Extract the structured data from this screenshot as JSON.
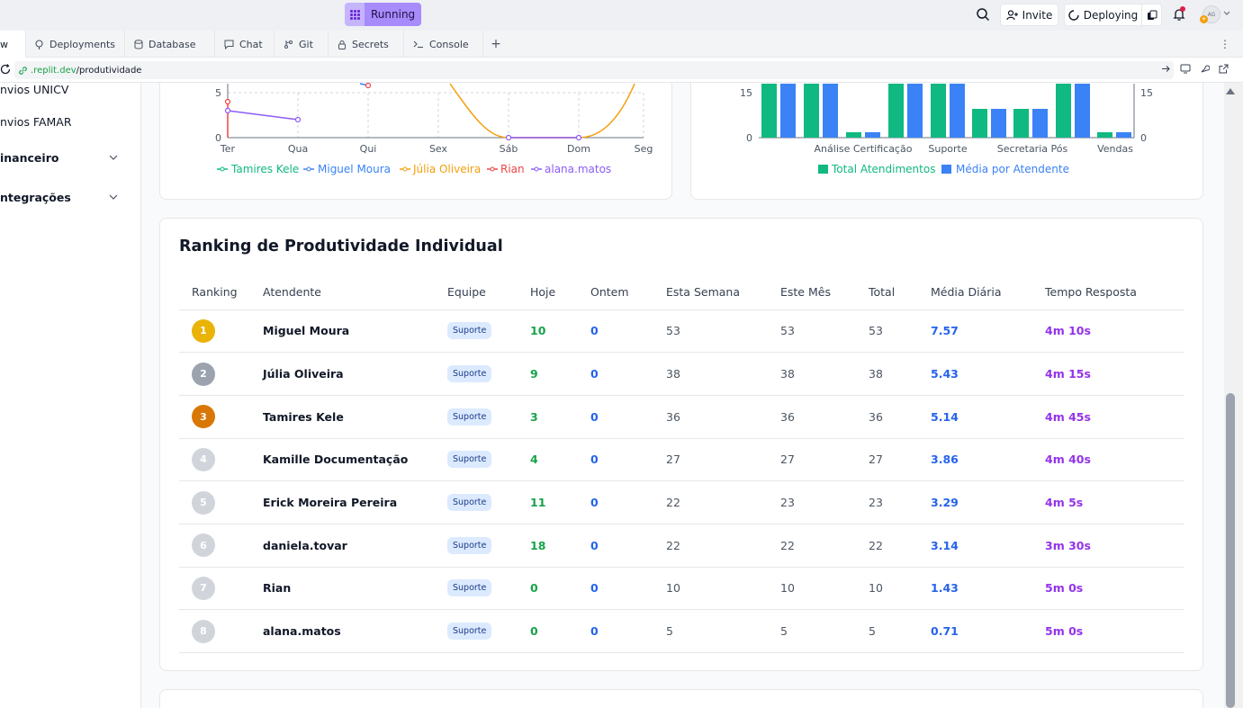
{
  "topbar": {
    "run_label": "Running",
    "invite_label": "Invite",
    "deploy_label": "Deploying",
    "avatar_initials": "AG",
    "avatar_badge": "+"
  },
  "tabs": [
    {
      "label": "w",
      "icon": "preview-icon",
      "active": true
    },
    {
      "label": "Deployments",
      "icon": "deploy-icon"
    },
    {
      "label": "Database",
      "icon": "database-icon"
    },
    {
      "label": "Chat",
      "icon": "chat-icon"
    },
    {
      "label": "Git",
      "icon": "git-icon"
    },
    {
      "label": "Secrets",
      "icon": "lock-icon"
    },
    {
      "label": "Console",
      "icon": "terminal-icon"
    }
  ],
  "tab_plus": "+",
  "tab_more": "⋮",
  "url": {
    "host": ".replit.dev",
    "path": "/produtividade"
  },
  "sidebar": {
    "items": [
      "nvios UNICV",
      "nvios FAMAR",
      "inanceiro",
      "ntegrações"
    ]
  },
  "line_chart": {
    "y_ticks": [
      "0",
      "5"
    ],
    "x_ticks": [
      "Ter",
      "Qua",
      "Qui",
      "Sex",
      "Sáb",
      "Dom",
      "Seg"
    ],
    "series": [
      {
        "name": "Tamires Kele",
        "color": "#10b981"
      },
      {
        "name": "Miguel Moura",
        "color": "#3b82f6"
      },
      {
        "name": "Júlia Oliveira",
        "color": "#f59e0b"
      },
      {
        "name": "Rian",
        "color": "#ef4444"
      },
      {
        "name": "alana.matos",
        "color": "#8b5cf6"
      }
    ]
  },
  "bar_chart": {
    "y_ticks": [
      "0",
      "15"
    ],
    "y2_ticks": [
      "0",
      "15"
    ],
    "x_ticks": [
      "Análise Certificação",
      "Suporte",
      "Secretaria Pós",
      "Vendas"
    ],
    "legend": [
      {
        "name": "Total Atendimentos",
        "color": "#10b981"
      },
      {
        "name": "Média por Atendente",
        "color": "#3b82f6"
      }
    ]
  },
  "ranking": {
    "title": "Ranking de Produtividade Individual",
    "headers": [
      "Ranking",
      "Atendente",
      "Equipe",
      "Hoje",
      "Ontem",
      "Esta Semana",
      "Este Mês",
      "Total",
      "Média Diária",
      "Tempo Resposta"
    ],
    "rows": [
      {
        "rank": "1",
        "color": "#eab308",
        "name": "Miguel Moura",
        "team": "Suporte",
        "hoje": "10",
        "ontem": "0",
        "semana": "53",
        "mes": "53",
        "total": "53",
        "media": "7.57",
        "tempo": "4m 10s"
      },
      {
        "rank": "2",
        "color": "#9ca3af",
        "name": "Júlia Oliveira",
        "team": "Suporte",
        "hoje": "9",
        "ontem": "0",
        "semana": "38",
        "mes": "38",
        "total": "38",
        "media": "5.43",
        "tempo": "4m 15s"
      },
      {
        "rank": "3",
        "color": "#d97706",
        "name": "Tamires Kele",
        "team": "Suporte",
        "hoje": "3",
        "ontem": "0",
        "semana": "36",
        "mes": "36",
        "total": "36",
        "media": "5.14",
        "tempo": "4m 45s"
      },
      {
        "rank": "4",
        "color": "#d1d5db",
        "name": "Kamille Documentação",
        "team": "Suporte",
        "hoje": "4",
        "ontem": "0",
        "semana": "27",
        "mes": "27",
        "total": "27",
        "media": "3.86",
        "tempo": "4m 40s"
      },
      {
        "rank": "5",
        "color": "#d1d5db",
        "name": "Erick Moreira Pereira",
        "team": "Suporte",
        "hoje": "11",
        "ontem": "0",
        "semana": "22",
        "mes": "23",
        "total": "23",
        "media": "3.29",
        "tempo": "4m 5s"
      },
      {
        "rank": "6",
        "color": "#d1d5db",
        "name": "daniela.tovar",
        "team": "Suporte",
        "hoje": "18",
        "ontem": "0",
        "semana": "22",
        "mes": "22",
        "total": "22",
        "media": "3.14",
        "tempo": "3m 30s"
      },
      {
        "rank": "7",
        "color": "#d1d5db",
        "name": "Rian",
        "team": "Suporte",
        "hoje": "0",
        "ontem": "0",
        "semana": "10",
        "mes": "10",
        "total": "10",
        "media": "1.43",
        "tempo": "5m 0s"
      },
      {
        "rank": "8",
        "color": "#d1d5db",
        "name": "alana.matos",
        "team": "Suporte",
        "hoje": "0",
        "ontem": "0",
        "semana": "5",
        "mes": "5",
        "total": "5",
        "media": "0.71",
        "tempo": "5m 0s"
      }
    ]
  }
}
